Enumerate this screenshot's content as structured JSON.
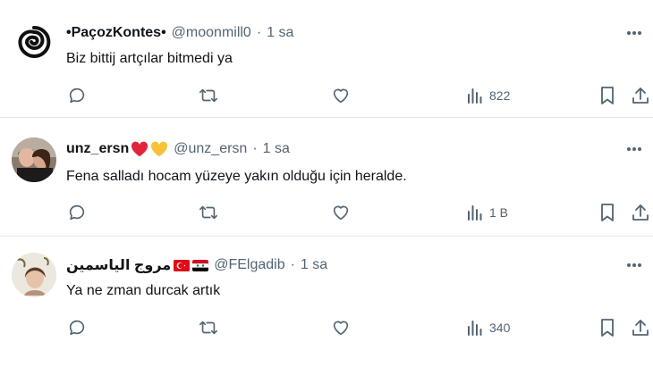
{
  "tweets": [
    {
      "display_name": "•PaçozKontes•",
      "handle": "@moonmill0",
      "separator": "·",
      "time": "1 sa",
      "text": "Biz bittij artçılar bitmedi ya",
      "views": "822",
      "avatar_icon": "spiral-logo-avatar"
    },
    {
      "display_name": "unz_ersn",
      "emojis": [
        "red-heart",
        "yellow-heart"
      ],
      "handle": "@unz_ersn",
      "separator": "·",
      "time": "1 sa",
      "text": "Fena salladı hocam yüzeye yakın olduğu için heralde.",
      "views": "1 B",
      "avatar_icon": "couple-photo-avatar"
    },
    {
      "display_name": "مروج الياسمين",
      "flags": [
        "turkey-flag",
        "syria-flag"
      ],
      "handle": "@FElgadib",
      "separator": "·",
      "time": "1 sa",
      "text": "Ya ne zman durcak artık",
      "views": "340",
      "avatar_icon": "portrait-avatar"
    }
  ],
  "icons": [
    "reply-icon",
    "retweet-icon",
    "like-icon",
    "views-icon",
    "bookmark-icon",
    "share-icon",
    "more-icon"
  ],
  "colors": {
    "text": "#0f1419",
    "secondary": "#536471",
    "divider": "#e4e8eb"
  }
}
